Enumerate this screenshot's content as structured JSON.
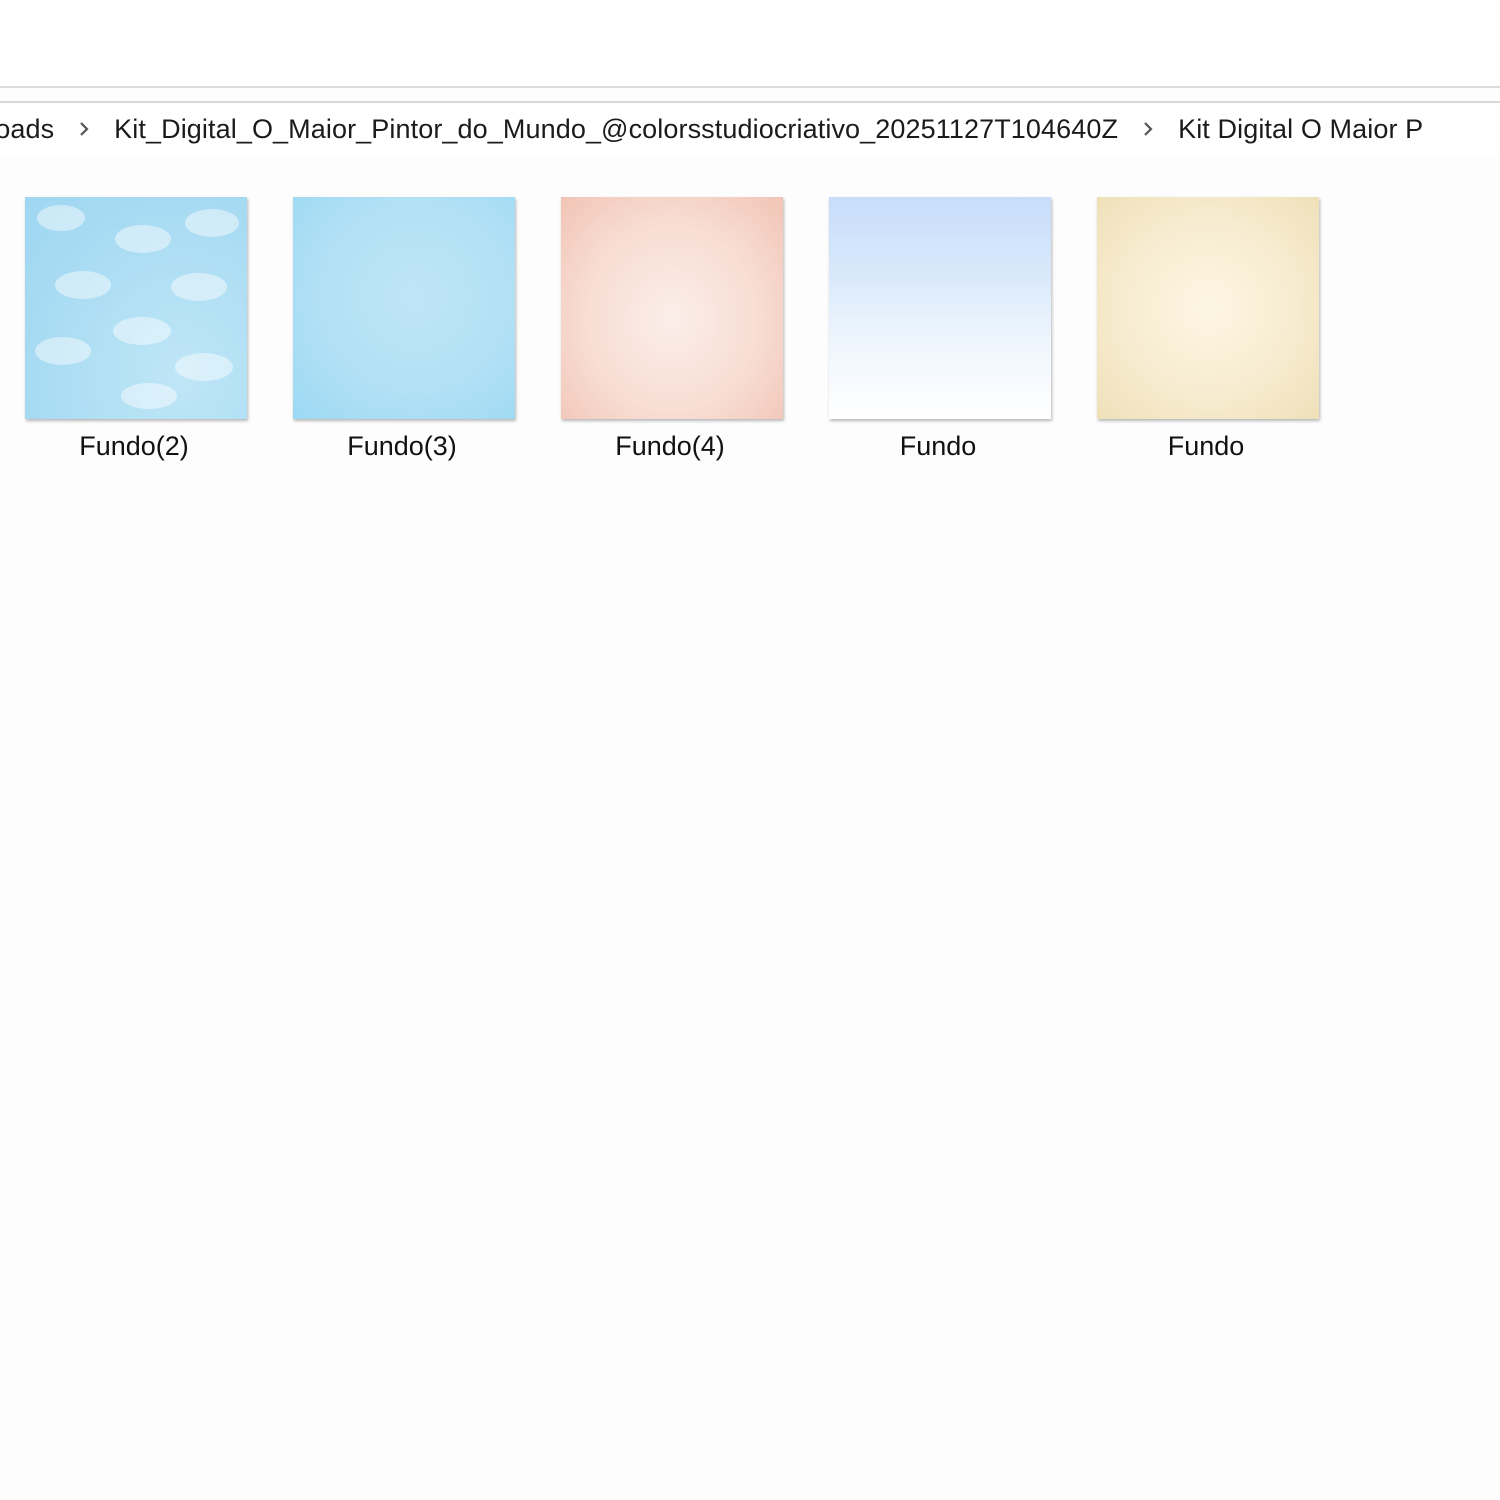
{
  "breadcrumb": {
    "items": [
      "nloads",
      "Kit_Digital_O_Maior_Pintor_do_Mundo_@colorsstudiocriativo_20251127T104640Z",
      "Kit Digital O Maior P"
    ]
  },
  "files": [
    {
      "name": "Fundo(2)"
    },
    {
      "name": "Fundo(3)"
    },
    {
      "name": "Fundo(4)"
    },
    {
      "name": "Fundo"
    },
    {
      "name": "Fundo"
    }
  ],
  "icons": {
    "separator": "chevron-right-icon"
  }
}
